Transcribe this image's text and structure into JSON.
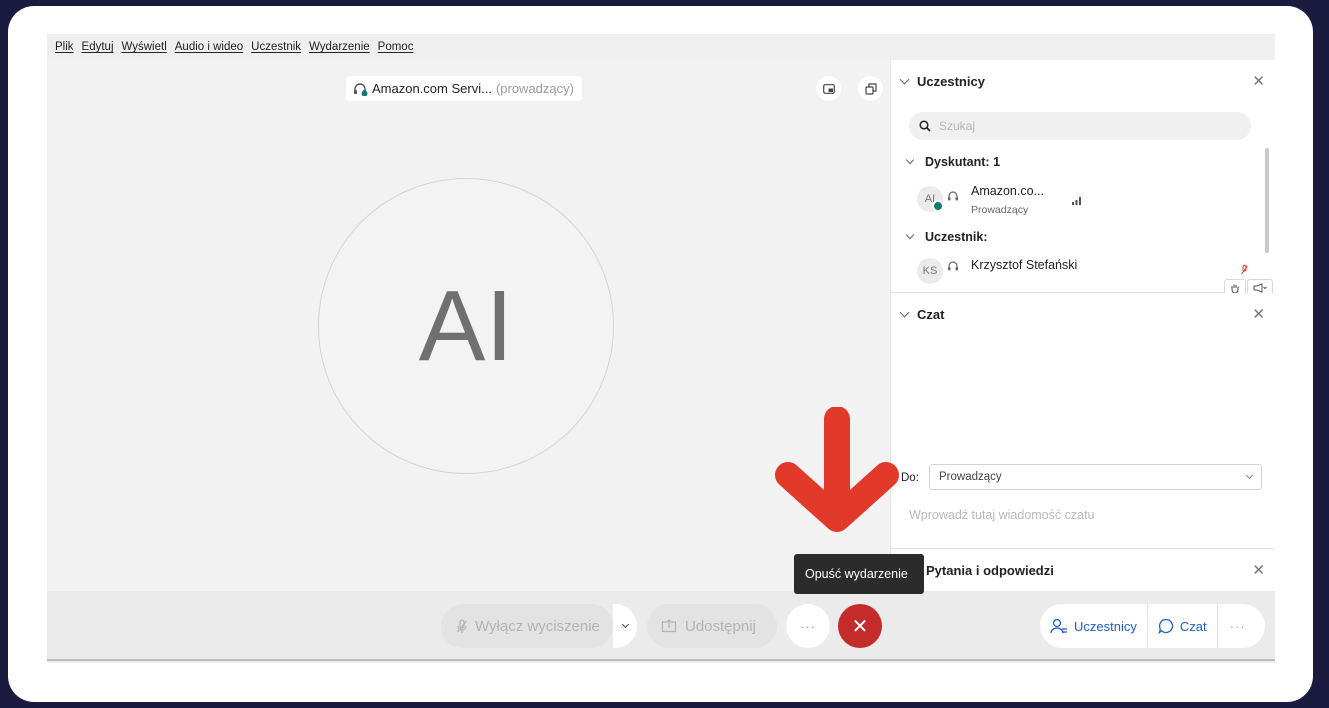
{
  "menu": [
    "Plik",
    "Edytuj",
    "Wyświetl",
    "Audio i wideo",
    "Uczestnik",
    "Wydarzenie",
    "Pomoc"
  ],
  "stage": {
    "host_name": "Amazon.com Servi...",
    "host_role": "(prowadzący)",
    "avatar_initials": "AI"
  },
  "participants_panel": {
    "title": "Uczestnicy",
    "search_placeholder": "Szukaj",
    "groups": [
      {
        "label": "Dyskutant: 1"
      },
      {
        "label": "Uczestnik:"
      }
    ],
    "members": [
      {
        "initials": "AI",
        "name": "Amazon.co...",
        "role": "Prowadzący"
      },
      {
        "initials": "KS",
        "name": "Krzysztof Stefański"
      }
    ]
  },
  "chat_panel": {
    "title": "Czat",
    "to_label": "Do:",
    "to_value": "Prowadzący",
    "input_placeholder": "Wprowadź tutaj wiadomość czatu"
  },
  "qa_panel": {
    "title": "Pytania i odpowiedzi"
  },
  "tooltip": "Opuść wydarzenie",
  "toolbar": {
    "mute_label": "Wyłącz wyciszenie",
    "share_label": "Udostępnij",
    "more_label": "···",
    "leave_label": "✕",
    "participants_label": "Uczestnicy",
    "chat_label": "Czat",
    "overflow_label": "···"
  },
  "colors": {
    "background": "#1b1a3f",
    "leave": "#c42b2b",
    "accent": "#1f5fbf",
    "arrow": "#e23a2a",
    "status": "#0e7d6e"
  },
  "icons": [
    "headset-icon",
    "picture-in-picture-icon",
    "popout-icon",
    "search-icon",
    "close-icon",
    "microphone-icon",
    "share-icon",
    "people-icon",
    "chat-bubble-icon",
    "hand-raise-icon",
    "megaphone-icon",
    "signal-icon"
  ]
}
